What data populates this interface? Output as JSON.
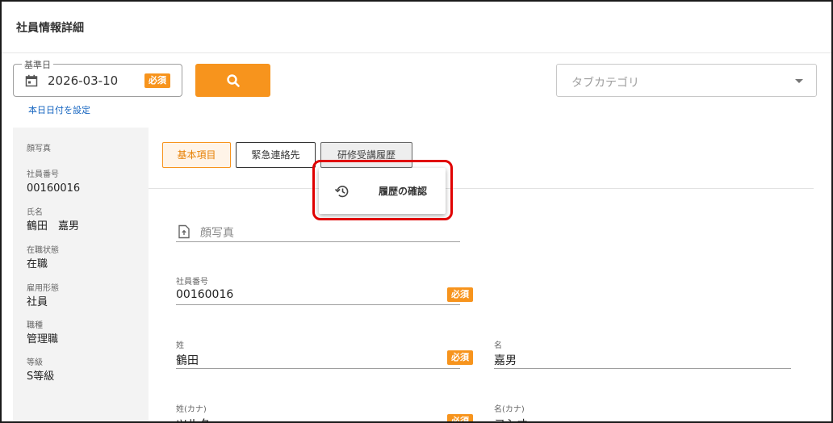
{
  "page_title": "社員情報詳細",
  "date_filter": {
    "legend": "基準日",
    "value": "2026-03-10",
    "required_badge": "必須",
    "today_link": "本日日付を設定"
  },
  "tab_category": {
    "placeholder": "タブカテゴリ"
  },
  "sidebar": {
    "items": [
      {
        "label": "顔写真",
        "value": ""
      },
      {
        "label": "社員番号",
        "value": "00160016"
      },
      {
        "label": "氏名",
        "value": "鶴田　嘉男"
      },
      {
        "label": "在職状態",
        "value": "在職"
      },
      {
        "label": "雇用形態",
        "value": "社員"
      },
      {
        "label": "職種",
        "value": "管理職"
      },
      {
        "label": "等級",
        "value": "S等級"
      }
    ]
  },
  "tabs": [
    {
      "label": "基本項目"
    },
    {
      "label": "緊急連絡先"
    },
    {
      "label": "研修受講履歴"
    }
  ],
  "popup": {
    "item_label": "履歴の確認"
  },
  "form": {
    "photo_label": "顔写真",
    "employee_no": {
      "label": "社員番号",
      "value": "00160016",
      "badge": "必須"
    },
    "last_name": {
      "label": "姓",
      "value": "鶴田",
      "badge": "必須"
    },
    "first_name": {
      "label": "名",
      "value": "嘉男"
    },
    "last_name_kana": {
      "label": "姓(カナ)",
      "value": "ツルタ",
      "badge": "必須"
    },
    "first_name_kana": {
      "label": "名(カナ)",
      "value": "ヨシオ"
    }
  },
  "colors": {
    "accent": "#f7941d",
    "link": "#1565c0",
    "highlight": "#e00000"
  }
}
